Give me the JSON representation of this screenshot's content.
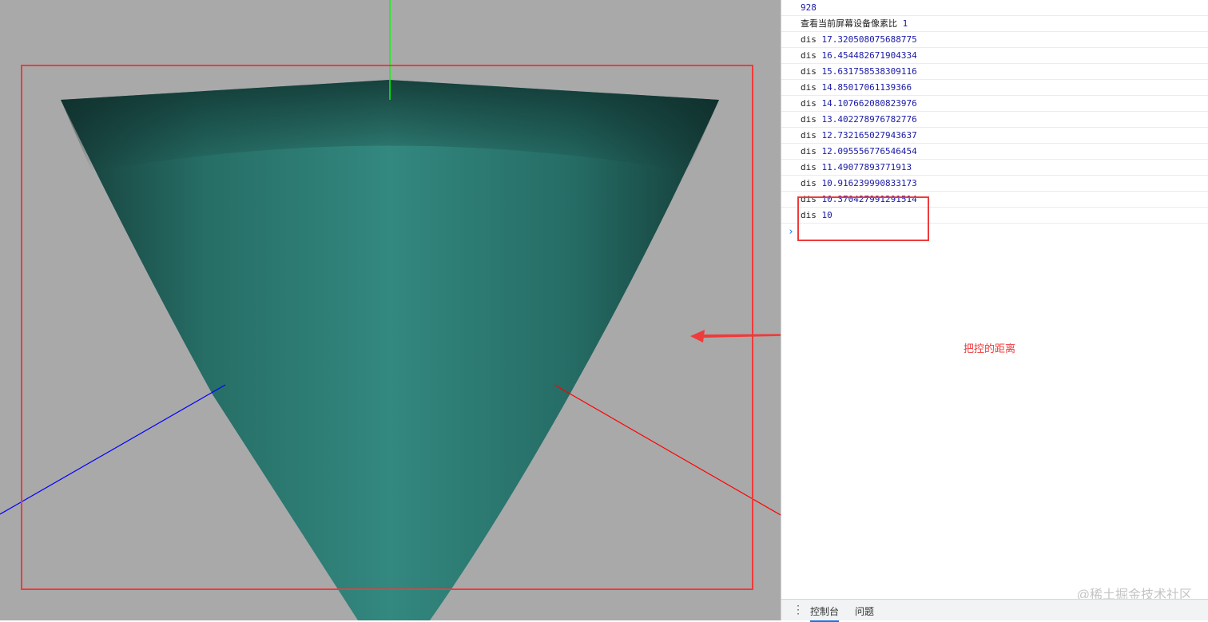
{
  "console": {
    "lines": [
      {
        "text": "928"
      },
      {
        "label": "查看当前屏幕设备像素比",
        "value": "1"
      },
      {
        "label": "dis",
        "value": "17.320508075688775"
      },
      {
        "label": "dis",
        "value": "16.454482671904334"
      },
      {
        "label": "dis",
        "value": "15.631758538309116"
      },
      {
        "label": "dis",
        "value": "14.85017061139366"
      },
      {
        "label": "dis",
        "value": "14.107662080823976"
      },
      {
        "label": "dis",
        "value": "13.402278976782776"
      },
      {
        "label": "dis",
        "value": "12.732165027943637"
      },
      {
        "label": "dis",
        "value": "12.095556776546454"
      },
      {
        "label": "dis",
        "value": "11.49077893771913"
      },
      {
        "label": "dis",
        "value": "10.916239990833173"
      },
      {
        "label": "dis",
        "value": "10.370427991291514"
      },
      {
        "label": "dis",
        "value": "10"
      }
    ],
    "prompt": "›",
    "tabs": [
      "控制台",
      "问题"
    ]
  },
  "annotation": {
    "text": "把控的距离"
  },
  "watermark": "@稀土掘金技术社区",
  "colors": {
    "background": "#a9a9a9",
    "cone": "#2e8a80",
    "annotation": "#ef3b3b",
    "axis_x": "#ff0000",
    "axis_y": "#00ff00",
    "axis_z": "#0000ff"
  }
}
